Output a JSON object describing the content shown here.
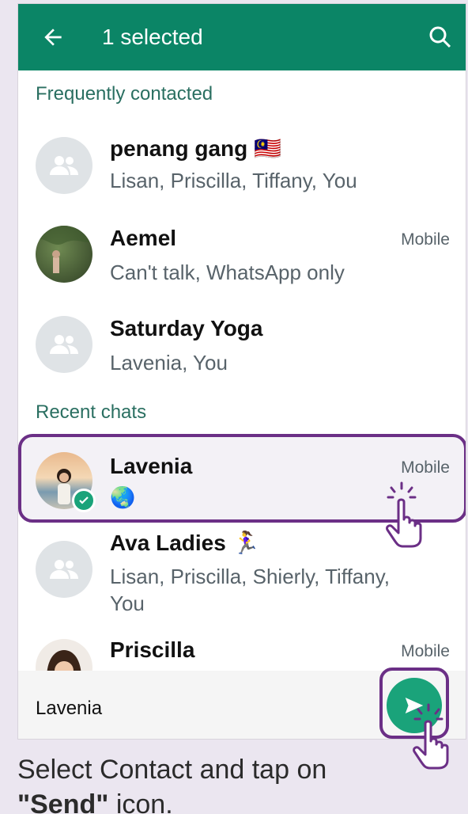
{
  "appbar": {
    "title": "1 selected",
    "background": "#0b8566"
  },
  "sections": {
    "frequent": "Frequently contacted",
    "recent": "Recent chats"
  },
  "contacts": [
    {
      "name": "penang gang 🇲🇾",
      "sub": "Lisan, Priscilla, Tiffany, You",
      "tag": "",
      "avatar": "group-icon"
    },
    {
      "name": "Aemel",
      "sub": "Can't talk, WhatsApp only",
      "tag": "Mobile",
      "avatar": "photo"
    },
    {
      "name": "Saturday Yoga",
      "sub": "Lavenia, You",
      "tag": "",
      "avatar": "group-icon"
    },
    {
      "name": "Lavenia",
      "sub": "🌏",
      "tag": "Mobile",
      "avatar": "photo",
      "selected": true
    },
    {
      "name": "Ava Ladies 🏃‍♀️",
      "sub": "Lisan, Priscilla, Shierly, Tiffany,",
      "sub2": "You",
      "tag": "",
      "avatar": "group-icon"
    },
    {
      "name": "Priscilla",
      "sub": "",
      "tag": "Mobile",
      "avatar": "photo"
    }
  ],
  "bottombar": {
    "selected_label": "Lavenia"
  },
  "caption": {
    "line1": "Select Contact and tap on",
    "line2_bold": "\"Send\"",
    "line2_rest": " icon."
  },
  "colors": {
    "highlight": "#6b2f86",
    "accent": "#1aa37a"
  }
}
